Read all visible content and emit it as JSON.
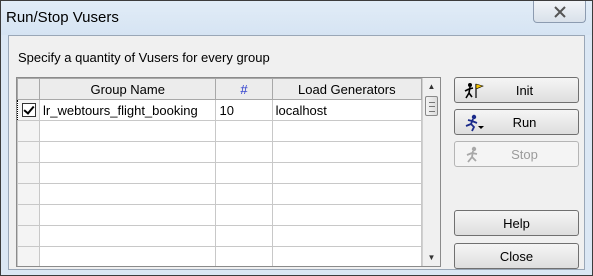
{
  "window": {
    "title": "Run/Stop Vusers",
    "close_icon": "close-icon"
  },
  "instruction": "Specify a quantity of Vusers for every group",
  "grid": {
    "headers": {
      "group_name": "Group Name",
      "count": "#",
      "load_generators": "Load Generators"
    },
    "rows": [
      {
        "checked": true,
        "group_name": "lr_webtours_flight_booking",
        "count": "10",
        "load_generator": "localhost"
      }
    ],
    "empty_rows": 7
  },
  "buttons": {
    "init": {
      "label": "Init",
      "icon": "flag-runner-icon"
    },
    "run": {
      "label": "Run",
      "icon": "running-man-icon"
    },
    "stop": {
      "label": "Stop",
      "icon": "stop-runner-icon",
      "disabled": true
    },
    "help": {
      "label": "Help"
    },
    "close": {
      "label": "Close"
    }
  }
}
